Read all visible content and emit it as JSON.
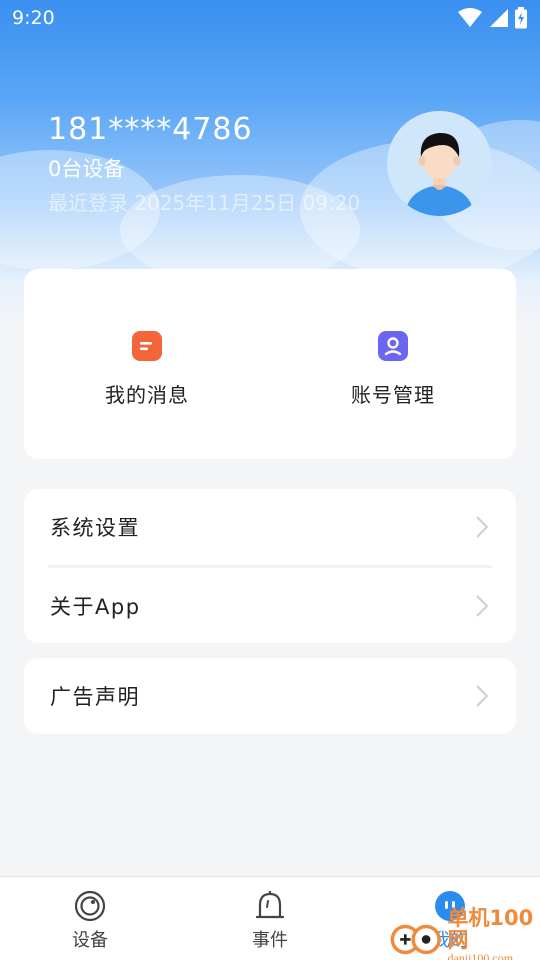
{
  "status_bar": {
    "time": "9:20",
    "icons": [
      "wifi-icon",
      "signal-icon",
      "battery-charging-icon"
    ]
  },
  "profile": {
    "phone": "181****4786",
    "device_count": "0台设备",
    "last_login": "最近登录 2025年11月25日 09:20"
  },
  "quick_actions": [
    {
      "label": "我的消息",
      "icon": "message-icon",
      "color": "#f2663a"
    },
    {
      "label": "账号管理",
      "icon": "account-icon",
      "color": "#6a66f0"
    }
  ],
  "menu": {
    "group1": [
      {
        "label": "系统设置"
      },
      {
        "label": "关于App"
      }
    ],
    "group2": [
      {
        "label": "广告声明"
      }
    ]
  },
  "tabbar": {
    "tabs": [
      {
        "label": "设备",
        "icon": "camera-icon"
      },
      {
        "label": "事件",
        "icon": "bell-icon"
      },
      {
        "label": "我的",
        "icon": "profile-tab-icon",
        "active": true
      }
    ]
  },
  "watermark": {
    "name": "单机100网",
    "url": "danji100.com"
  },
  "colors": {
    "accent": "#2b8cf0",
    "hero_top": "#3a8ff0",
    "background": "#f4f5f7"
  }
}
